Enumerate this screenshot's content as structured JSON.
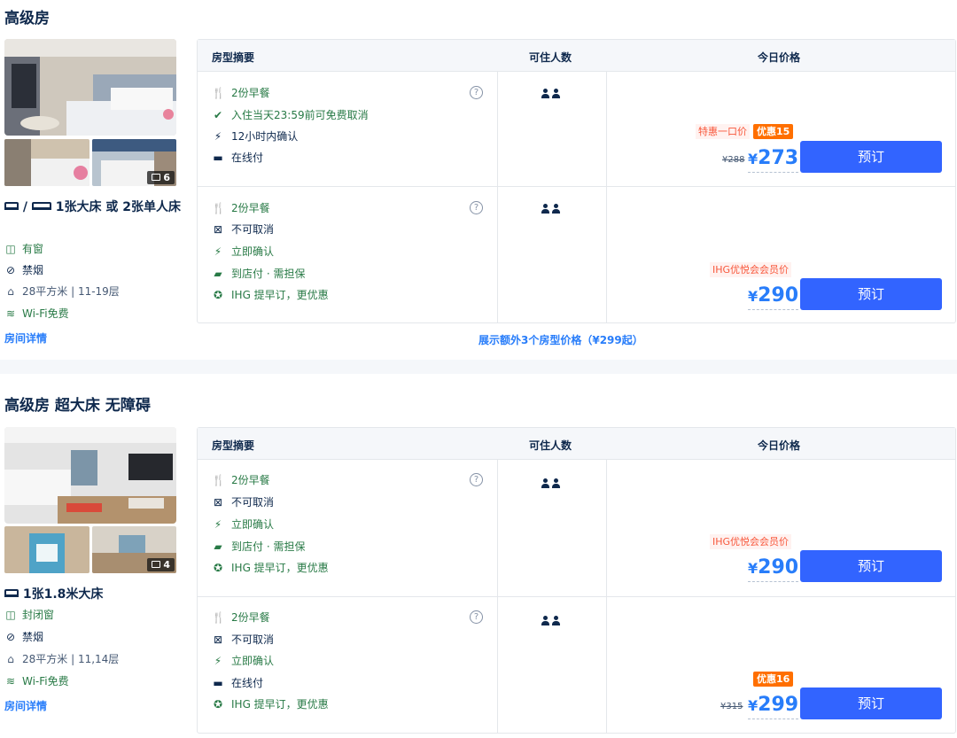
{
  "rooms": [
    {
      "title": "高级房",
      "photo_count": "6",
      "bed": "1张大床 或 2张单人床",
      "facilities": [
        "有窗",
        "禁烟",
        "28平方米 | 11-19层",
        "Wi-Fi免费"
      ],
      "details_link": "房间详情",
      "headers": {
        "summary": "房型摘要",
        "occupancy": "可住人数",
        "price": "今日价格"
      },
      "plans": [
        {
          "features": [
            "2份早餐",
            "入住当天23:59前可免费取消",
            "12小时内确认",
            "在线付"
          ],
          "promo_label": "特惠一口价",
          "discount": "优惠15",
          "old_price": "¥288",
          "price": "273",
          "book": "预订"
        },
        {
          "features": [
            "2份早餐",
            "不可取消",
            "立即确认",
            "到店付 · 需担保",
            "IHG 提早订，更优惠"
          ],
          "promo_label": "IHG优悦会会员价",
          "price": "290",
          "book": "预订"
        }
      ],
      "more_link": "展示额外3个房型价格（¥299起）"
    },
    {
      "title": "高级房 超大床 无障碍",
      "photo_count": "4",
      "bed": "1张1.8米大床",
      "facilities": [
        "封闭窗",
        "禁烟",
        "28平方米 | 11,14层",
        "Wi-Fi免费"
      ],
      "details_link": "房间详情",
      "headers": {
        "summary": "房型摘要",
        "occupancy": "可住人数",
        "price": "今日价格"
      },
      "plans": [
        {
          "features": [
            "2份早餐",
            "不可取消",
            "立即确认",
            "到店付 · 需担保",
            "IHG 提早订，更优惠"
          ],
          "promo_label": "IHG优悦会会员价",
          "price": "290",
          "book": "预订"
        },
        {
          "features": [
            "2份早餐",
            "不可取消",
            "立即确认",
            "在线付",
            "IHG 提早订，更优惠"
          ],
          "discount": "优惠16",
          "old_price": "¥315",
          "price": "299",
          "book": "预订"
        }
      ]
    }
  ],
  "currency": "¥",
  "colors": {
    "accent": "#287dfa",
    "button": "#3264ff",
    "green": "#287a46",
    "promo_red": "#f8583c",
    "discount_orange": "#ff6f00"
  }
}
